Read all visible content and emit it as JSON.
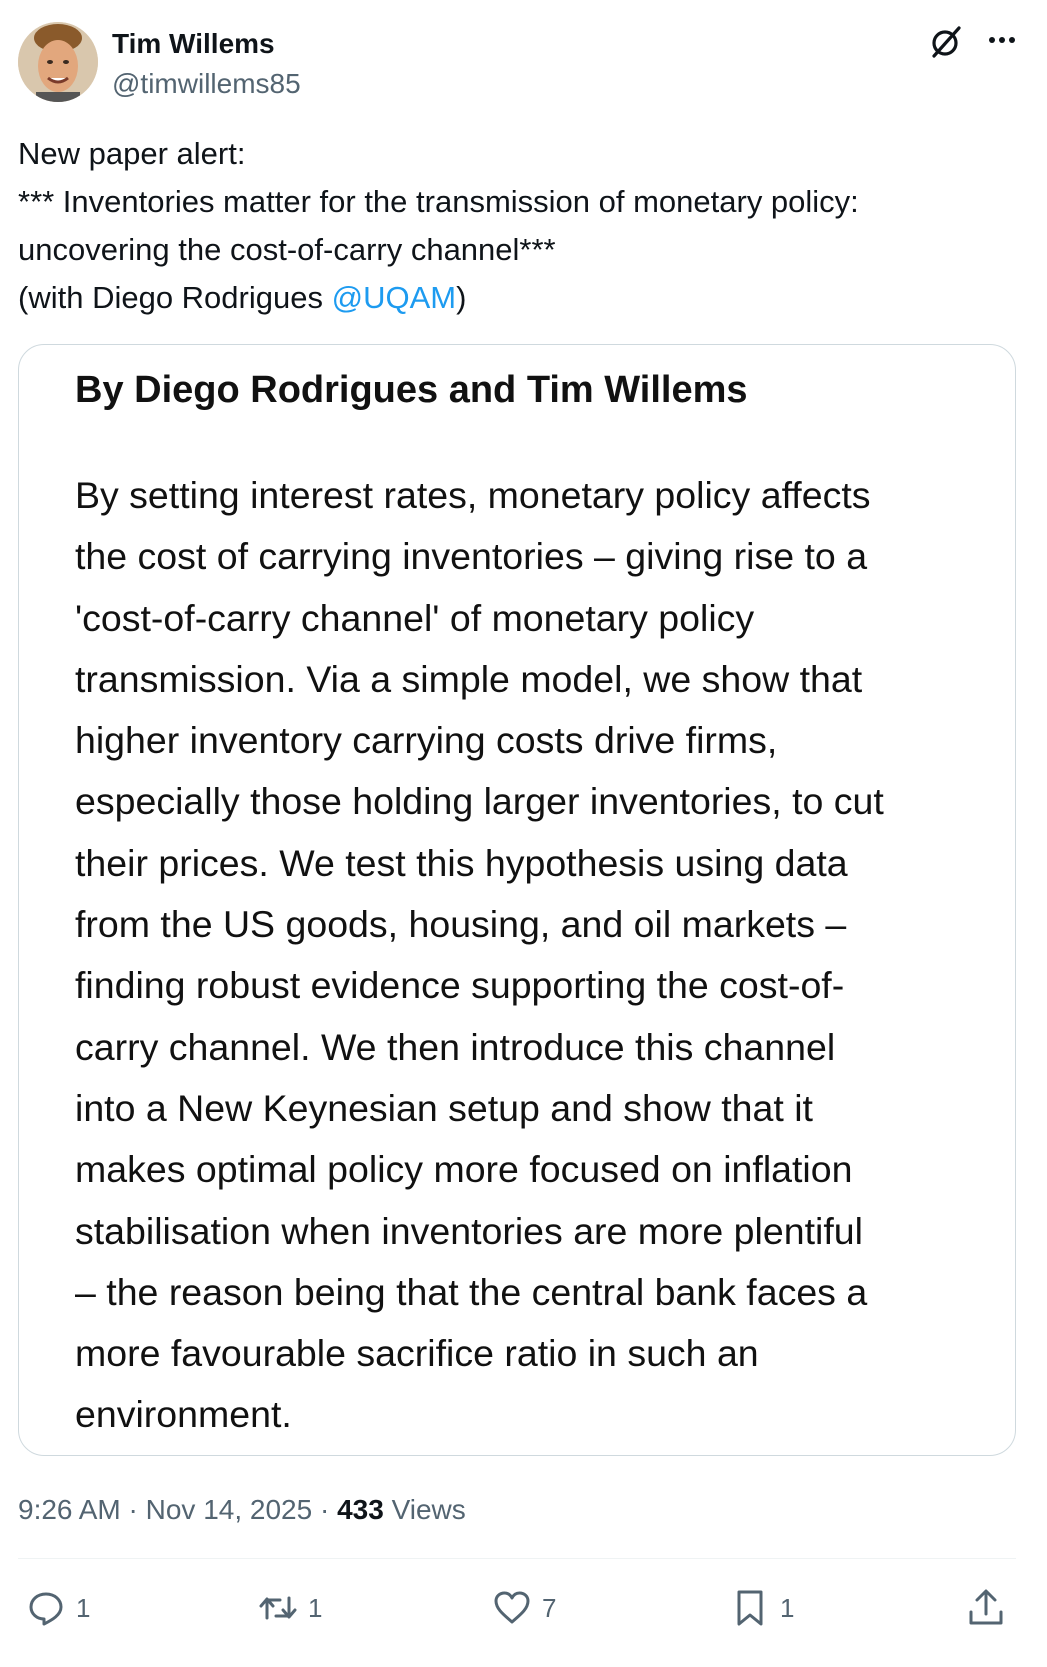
{
  "author": {
    "display_name": "Tim Willems",
    "handle": "@timwillems85",
    "avatar_icon": "profile-photo"
  },
  "header_icons": {
    "grok": "grok-slash-icon",
    "more": "more-dots-icon"
  },
  "tweet": {
    "lines": [
      "New paper alert:",
      "*** Inventories matter for the transmission of monetary policy:",
      "uncovering the cost-of-carry channel***"
    ],
    "last_line_prefix": "(with Diego Rodrigues ",
    "mention": "@UQAM",
    "last_line_suffix": ")"
  },
  "media": {
    "authors": "By Diego Rodrigues and Tim Willems",
    "abstract_lines": [
      "By setting interest rates, monetary policy affects",
      "the cost of carrying inventories – giving rise to a",
      "'cost-of-carry channel' of monetary policy",
      "transmission. Via a simple model, we show that",
      "higher inventory carrying costs drive firms,",
      "especially those holding larger inventories, to cut",
      "their prices. We test this hypothesis using data",
      "from the US goods, housing, and oil markets –",
      "finding robust evidence supporting the cost-of-",
      "carry channel. We then introduce this channel",
      "into a New Keynesian setup and show that it",
      "makes optimal policy more focused on inflation",
      "stabilisation when inventories are more plentiful",
      "– the reason being that the central bank faces a",
      "more favourable sacrifice ratio in such an",
      "environment."
    ]
  },
  "meta": {
    "time": "9:26 AM",
    "separator": " · ",
    "date": "Nov 14, 2025",
    "views_count": "433",
    "views_label": " Views"
  },
  "actions": {
    "replies": "1",
    "reposts": "1",
    "likes": "7",
    "bookmarks": "1"
  },
  "colors": {
    "text": "#0f1419",
    "secondary": "#536471",
    "accent": "#1d9bf0",
    "border": "#cfd9de"
  }
}
